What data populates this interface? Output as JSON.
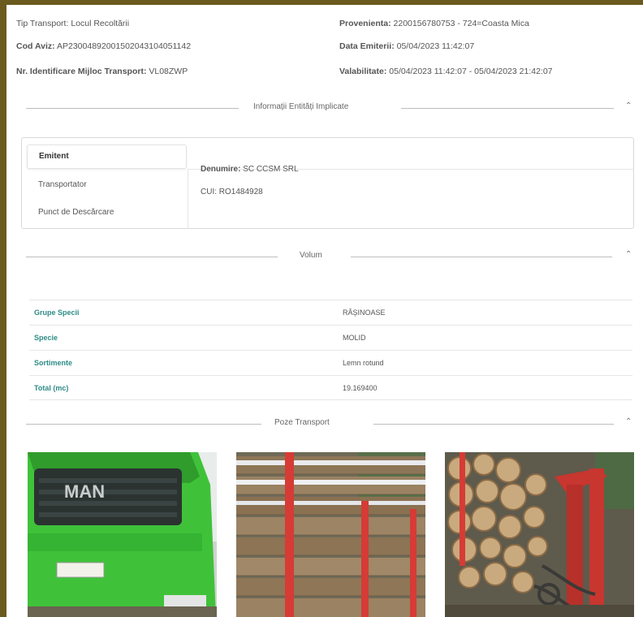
{
  "header": {
    "tip_transport_label": "Tip Transport:",
    "tip_transport_value": "Locul Recoltării",
    "cod_aviz_label": "Cod Aviz:",
    "cod_aviz_value": "AP23004892001502043104051142",
    "nr_identificare_label": "Nr. Identificare Mijloc Transport:",
    "nr_identificare_value": "VL08ZWP",
    "provenienta_label": "Provenienta:",
    "provenienta_value": "2200156780753 - 724=Coasta Mica",
    "data_emitere_label": "Data Emiterii:",
    "data_emitere_value": "05/04/2023 11:42:07",
    "valabilitate_label": "Valabilitate:",
    "valabilitate_value": "05/04/2023 11:42:07 - 05/04/2023 21:42:07"
  },
  "sections": {
    "entitati_title": "Informații Entități Implicate",
    "volum_title": "Volum",
    "poze_title": "Poze Transport"
  },
  "entities": {
    "tabs": [
      "Emitent",
      "Transportator",
      "Punct de Descărcare"
    ],
    "denumire_label": "Denumire:",
    "denumire_value": "SC CCSM SRL",
    "cui_label": "CUI:",
    "cui_value": "RO1484928"
  },
  "volume": {
    "rows": [
      {
        "key": "Grupe Specii",
        "value": "RĂȘINOASE"
      },
      {
        "key": "Specie",
        "value": "MOLID"
      },
      {
        "key": "Sortimente",
        "value": "Lemn rotund"
      },
      {
        "key": "Total (mc)",
        "value": "19.169400"
      }
    ]
  },
  "photos": [
    "truck-front-photo",
    "log-load-photo",
    "log-crane-photo"
  ],
  "colors": {
    "frame": "#6b5a1e",
    "accent_teal": "#2e8b86",
    "truck_green": "#3fc23a",
    "post_red": "#d63b35"
  }
}
